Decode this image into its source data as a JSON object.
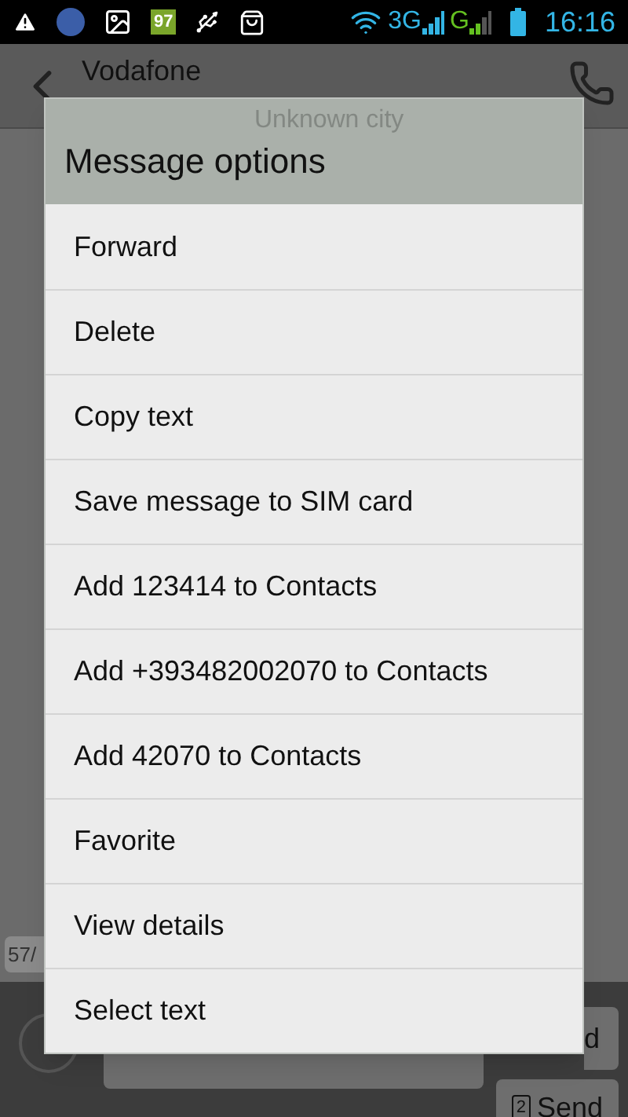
{
  "status_bar": {
    "battery": "97",
    "network_1": "3G",
    "network_2": "G",
    "time": "16:16"
  },
  "header": {
    "title": "Vodafone",
    "subtitle": "Unknown city"
  },
  "counter": "57/",
  "send_button_partial": "d",
  "send_button": {
    "sim": "2",
    "label": "Send"
  },
  "dialog": {
    "title": "Message options",
    "items": [
      {
        "label": "Forward"
      },
      {
        "label": "Delete"
      },
      {
        "label": "Copy text"
      },
      {
        "label": "Save message to SIM card"
      },
      {
        "label": "Add 123414 to Contacts"
      },
      {
        "label": "Add +393482002070 to Contacts"
      },
      {
        "label": "Add 42070 to Contacts"
      },
      {
        "label": "Favorite"
      },
      {
        "label": "View details"
      },
      {
        "label": "Select text"
      }
    ]
  }
}
